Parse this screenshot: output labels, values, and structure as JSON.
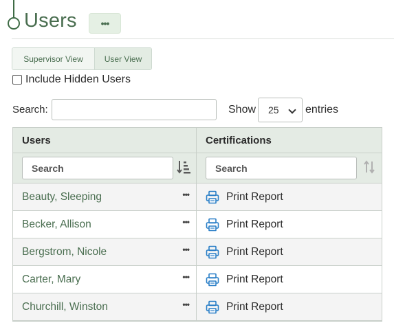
{
  "header": {
    "title": "Users",
    "menu_icon": "ellipsis-icon"
  },
  "view_toggle": {
    "supervisor_label": "Supervisor View",
    "user_label": "User View",
    "active": "User View"
  },
  "include_hidden": {
    "label": "Include Hidden Users",
    "checked": false
  },
  "search": {
    "label": "Search:",
    "value": ""
  },
  "page_length": {
    "show_label": "Show",
    "value": "25",
    "entries_label": "entries"
  },
  "table": {
    "columns": [
      {
        "label": "Users",
        "filter_placeholder": "Search",
        "sort": "ascending"
      },
      {
        "label": "Certifications",
        "filter_placeholder": "Search",
        "sort": "none"
      }
    ],
    "rows": [
      {
        "name": "Beauty, Sleeping",
        "certification": "Print Report"
      },
      {
        "name": "Becker, Allison",
        "certification": "Print Report"
      },
      {
        "name": "Bergstrom, Nicole",
        "certification": "Print Report"
      },
      {
        "name": "Carter, Mary",
        "certification": "Print Report"
      },
      {
        "name": "Churchill, Winston",
        "certification": "Print Report"
      }
    ]
  },
  "colors": {
    "accent": "#4a6e50",
    "header_bg": "#e4ebe4",
    "icon_blue": "#2a7fc7"
  }
}
